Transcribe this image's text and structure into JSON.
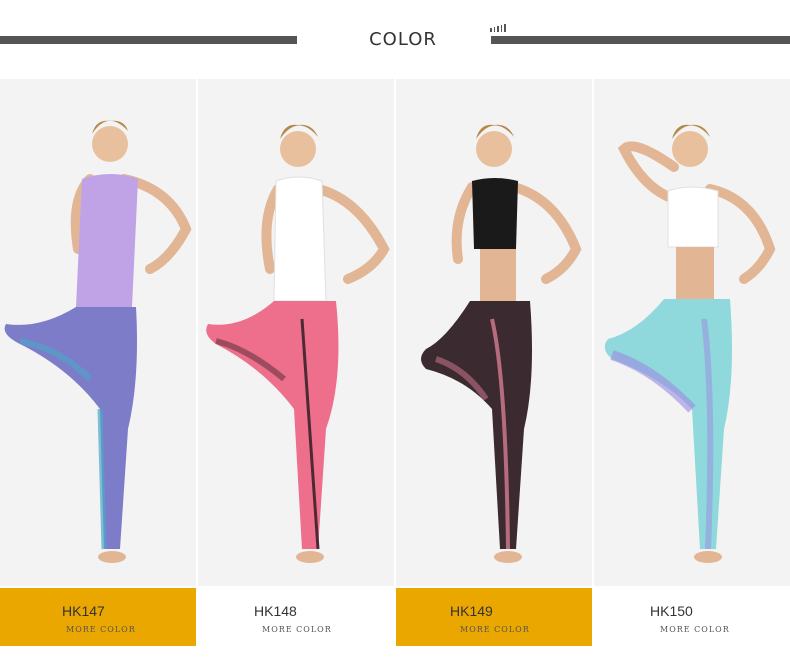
{
  "header": {
    "title": "COLOR"
  },
  "products": [
    {
      "code": "HK147",
      "more": "MORE COLOR",
      "band": "gold",
      "top_color": "#bfa3e6",
      "legging_color": "#7d7cc9",
      "legging_accent": "#4aa8c8"
    },
    {
      "code": "HK148",
      "more": "MORE COLOR",
      "band": "plain",
      "top_color": "#ffffff",
      "legging_color": "#ee6f8b",
      "legging_accent": "#4b2a33"
    },
    {
      "code": "HK149",
      "more": "MORE COLOR",
      "band": "gold",
      "top_color": "#1a1a1a",
      "legging_color": "#3b2a30",
      "legging_accent": "#d77c93"
    },
    {
      "code": "HK150",
      "more": "MORE COLOR",
      "band": "plain",
      "top_color": "#ffffff",
      "legging_color": "#8fd8dc",
      "legging_accent": "#9c8be0"
    }
  ],
  "colors": {
    "gold": "#e9a700",
    "rule": "#555555"
  }
}
